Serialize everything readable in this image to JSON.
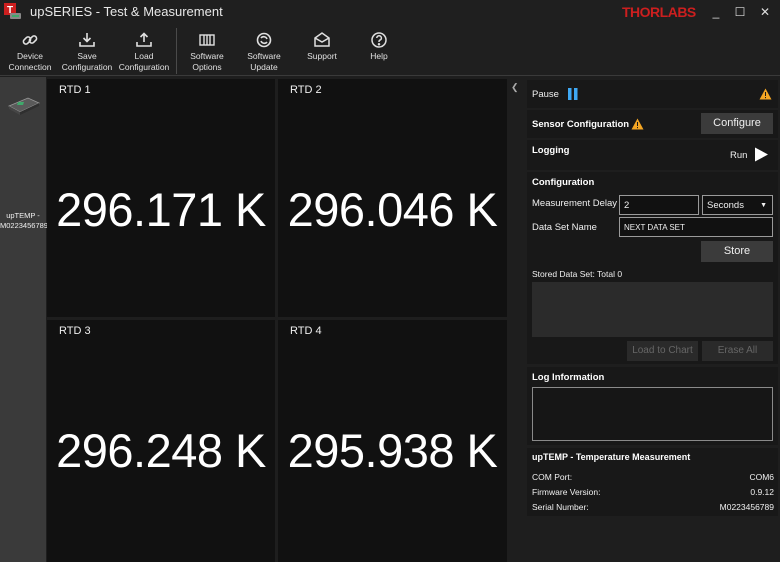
{
  "window": {
    "title": "upSERIES - Test & Measurement",
    "brand": "THORLABS",
    "controls": [
      "_",
      "☐",
      "✕"
    ]
  },
  "toolbar": [
    {
      "label": "Device\nConnection",
      "icon": "link-icon"
    },
    {
      "label": "Save\nConfiguration",
      "icon": "download-icon"
    },
    {
      "label": "Load\nConfiguration",
      "icon": "upload-icon"
    },
    {
      "label": "Software\nOptions",
      "icon": "grid-icon"
    },
    {
      "label": "Software\nUpdate",
      "icon": "refresh-icon"
    },
    {
      "label": "Support",
      "icon": "envelope-icon"
    },
    {
      "label": "Help",
      "icon": "question-icon"
    }
  ],
  "device": {
    "label": "upTEMP -\nM0223456789"
  },
  "rtd": [
    {
      "title": "RTD 1",
      "value": "296.171 K"
    },
    {
      "title": "RTD 2",
      "value": "296.046 K"
    },
    {
      "title": "RTD 3",
      "value": "296.248 K"
    },
    {
      "title": "RTD 4",
      "value": "295.938 K"
    }
  ],
  "panel": {
    "pause_label": "Pause",
    "sensor_config_title": "Sensor Configuration",
    "configure_button": "Configure",
    "logging_title": "Logging",
    "run_label": "Run",
    "configuration_title": "Configuration",
    "measurement_delay_label": "Measurement Delay",
    "measurement_delay_value": "2",
    "delay_unit": "Seconds",
    "data_set_name_label": "Data Set Name",
    "data_set_name_value": "NEXT DATA SET",
    "store_button": "Store",
    "stored_data_set": "Stored Data Set: Total 0",
    "load_chart_button": "Load to Chart",
    "erase_all_button": "Erase All",
    "log_info_title": "Log Information",
    "device_info_title": "upTEMP - Temperature Measurement",
    "info": [
      {
        "label": "COM Port:",
        "value": "COM6"
      },
      {
        "label": "Firmware Version:",
        "value": "0.9.12"
      },
      {
        "label": "Serial Number:",
        "value": "M0223456789"
      }
    ]
  },
  "colors": {
    "accent_warning": "#f5a623",
    "pause_blue": "#3fa9f5",
    "brand_red": "#cc1f1f"
  }
}
